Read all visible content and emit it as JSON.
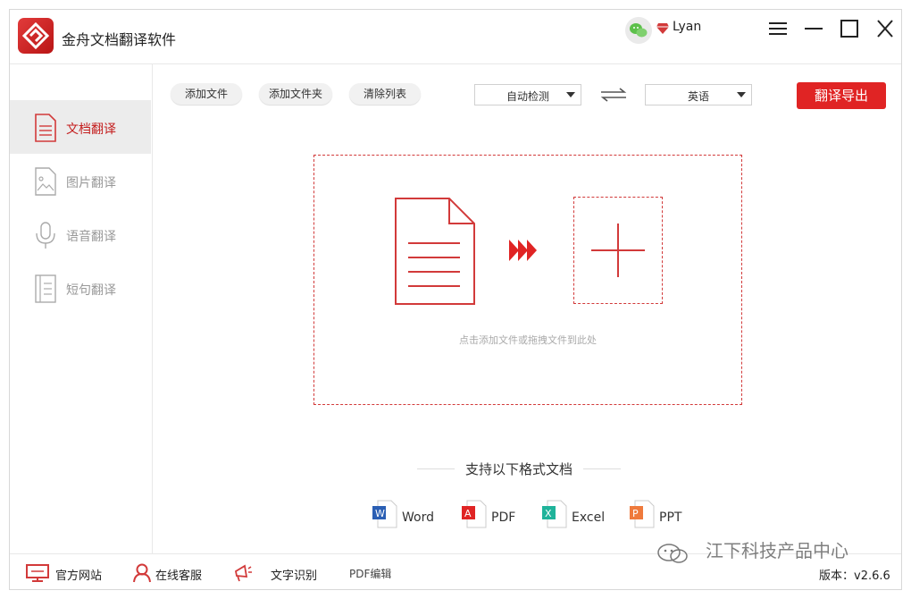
{
  "app": {
    "title": "金舟文档翻译软件",
    "username": "Lyan"
  },
  "window_controls": [
    "menu-icon",
    "minimize-icon",
    "maximize-icon",
    "close-icon"
  ],
  "sidebar": {
    "items": [
      {
        "label": "文档翻译",
        "icon": "document-icon",
        "active": true
      },
      {
        "label": "图片翻译",
        "icon": "image-icon",
        "active": false
      },
      {
        "label": "语音翻译",
        "icon": "microphone-icon",
        "active": false
      },
      {
        "label": "短句翻译",
        "icon": "notebook-icon",
        "active": false
      }
    ]
  },
  "toolbar": {
    "add_file": "添加文件",
    "add_folder": "添加文件夹",
    "clear_list": "清除列表",
    "source_lang": "自动检测",
    "target_lang": "英语",
    "export": "翻译导出"
  },
  "dropzone": {
    "hint": "点击添加文件或拖拽文件到此处"
  },
  "formats": {
    "title": "支持以下格式文档",
    "items": [
      {
        "name": "Word",
        "badge": "W",
        "color": "#2b5fb4"
      },
      {
        "name": "PDF",
        "badge": "A",
        "color": "#e02424"
      },
      {
        "name": "Excel",
        "badge": "X",
        "color": "#1fb39a"
      },
      {
        "name": "PPT",
        "badge": "P",
        "color": "#ef7a3c"
      }
    ]
  },
  "bottombar": {
    "website": "官方网站",
    "support": "在线客服",
    "ocr": "文字识别",
    "pdf_edit": "PDF编辑",
    "version": "版本：v2.6.6"
  },
  "watermark": "江下科技产品中心",
  "colors": {
    "accent": "#e02424",
    "active_text": "#c41e1e"
  }
}
